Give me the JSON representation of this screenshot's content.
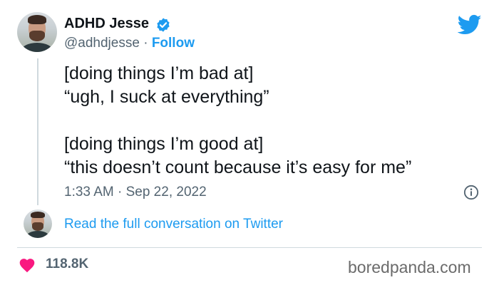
{
  "author": {
    "name": "ADHD Jesse",
    "handle": "@adhdjesse",
    "separator": "·",
    "follow_label": "Follow"
  },
  "tweet": {
    "lines": [
      "[doing things I’m bad at]",
      "“ugh, I suck at everything”",
      "",
      "[doing things I’m good at]",
      "“this doesn’t count because it’s easy for me”"
    ],
    "timestamp": "1:33 AM · Sep 22, 2022"
  },
  "conversation_link": "Read the full conversation on Twitter",
  "likes": "118.8K",
  "watermark": "boredpanda.com",
  "icons": {
    "verified": "verified-badge-icon",
    "bird": "twitter-bird-icon",
    "info": "info-icon",
    "heart": "heart-icon"
  },
  "colors": {
    "accent": "#1d9bf0",
    "text": "#0f1419",
    "secondary": "#536471",
    "heart": "#f91880",
    "divider": "#cfd9de"
  }
}
